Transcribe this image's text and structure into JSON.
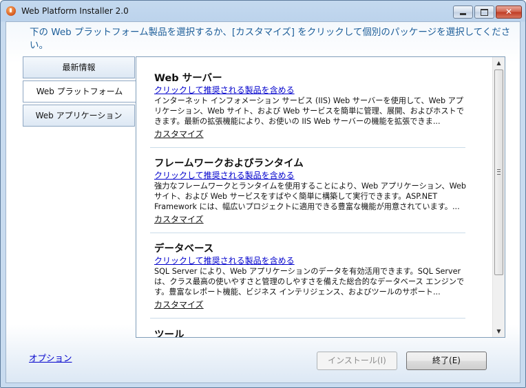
{
  "window": {
    "title": "Web Platform Installer 2.0",
    "controls": {
      "minimize": "minimize",
      "maximize": "maximize",
      "close": "✕"
    }
  },
  "instruction": "下の Web プラットフォーム製品を選択するか、[カスタマイズ] をクリックして個別のパッケージを選択してください。",
  "tabs": [
    {
      "label": "最新情報",
      "active": false
    },
    {
      "label": "Web プラットフォーム",
      "active": true
    },
    {
      "label": "Web アプリケーション",
      "active": false
    }
  ],
  "sections": [
    {
      "title": "Web サーバー",
      "link": "クリックして推奨される製品を含める",
      "description": "インターネット インフォメーション サービス (IIS) Web サーバーを使用して、Web アプリケーション、Web サイト、および Web サービスを簡単に管理、展開、およびホストできます。最新の拡張機能により、お使いの IIS Web サーバーの機能を拡張できま...",
      "customize": "カスタマイズ"
    },
    {
      "title": "フレームワークおよびランタイム",
      "link": "クリックして推奨される製品を含める",
      "description": "強力なフレームワークとランタイムを使用することにより、Web アプリケーション、Web サイト、および Web サービスをすばやく簡単に構築して実行できます。ASP.NET Framework には、幅広いプロジェクトに適用できる豊富な機能が用意されています。...",
      "customize": "カスタマイズ"
    },
    {
      "title": "データベース",
      "link": "クリックして推奨される製品を含める",
      "description": "SQL Server により、Web アプリケーションのデータを有効活用できます。SQL Server は、クラス最高の使いやすさと管理のしやすさを備えた総合的なデータベース エンジンです。豊富なレポート機能、ビジネス インテリジェンス、およびツールのサポート...",
      "customize": "カスタマイズ"
    },
    {
      "title": "ツール"
    }
  ],
  "footer": {
    "options": "オプション",
    "install": "インストール(I)",
    "exit": "終了(E)"
  }
}
